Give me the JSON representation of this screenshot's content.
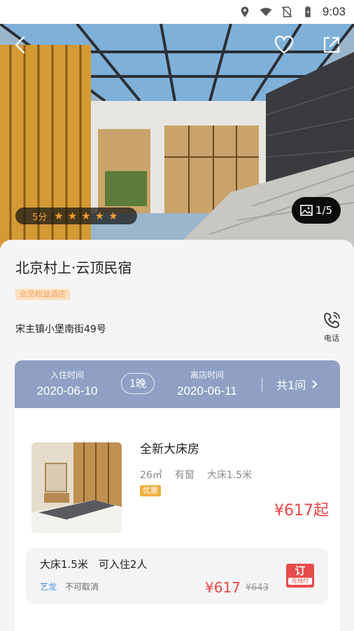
{
  "status_bar": {
    "time": "9:03"
  },
  "hero": {
    "score": "5分",
    "stars": [
      "★",
      "★",
      "★",
      "★",
      "★"
    ],
    "photo_counter": "1/5"
  },
  "hotel": {
    "name": "北京村上·云顶民宿",
    "badge": "会员权益酒店",
    "address": "宋主镇小堡南街49号",
    "phone_label": "电话"
  },
  "booking": {
    "checkin_label": "入住时间",
    "checkin_date": "2020-06-10",
    "nights": "1晚",
    "checkout_label": "离店时间",
    "checkout_date": "2020-06-11",
    "rooms": "共1间"
  },
  "room": {
    "name": "全新大床房",
    "tags": [
      "26㎡",
      "有窗",
      "大床1.5米"
    ],
    "discount_badge": "优惠",
    "price_from": "¥617起",
    "rate": {
      "title": "大床1.5米　可入住2人",
      "source": "艺龙",
      "cancel_policy": "不可取消",
      "price": "¥617",
      "original_price": "¥643",
      "book_label": "订",
      "book_sub": "在线付"
    }
  },
  "colors": {
    "accent_red": "#ee4444",
    "date_bar": "#8fa0c4",
    "star": "#f0a030"
  }
}
